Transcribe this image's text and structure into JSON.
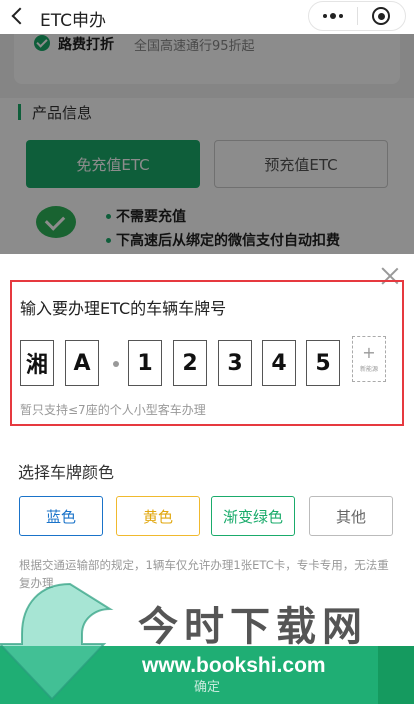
{
  "navbar": {
    "title": "ETC申办"
  },
  "background": {
    "benefit_title": "路费打折",
    "benefit_desc": "全国高速通行95折起",
    "section_title": "产品信息",
    "product_types": [
      "免充值ETC",
      "预充值ETC"
    ],
    "features": [
      "不需要充值",
      "下高速后从绑定的微信支付自动扣费"
    ]
  },
  "plate": {
    "heading": "输入要办理ETC的车辆车牌号",
    "chars": [
      "湘",
      "A",
      "1",
      "2",
      "3",
      "4",
      "5"
    ],
    "new_energy_plus": "+",
    "new_energy_label": "新能源",
    "hint": "暂只支持≤7座的个人小型客车办理"
  },
  "plate_color": {
    "heading": "选择车牌颜色",
    "options": [
      "蓝色",
      "黄色",
      "渐变绿色",
      "其他"
    ]
  },
  "notice": "根据交通运输部的规定，1辆车仅允许办理1张ETC卡，专卡专用，无法重复办理",
  "confirm_label": "确定",
  "watermark": {
    "text": "今时下载网",
    "url": "www.bookshi.com"
  },
  "colors": {
    "accent": "#1aab6b",
    "alert_border": "#e6393f",
    "blue": "#1a73c9",
    "yellow": "#f0b92e"
  }
}
